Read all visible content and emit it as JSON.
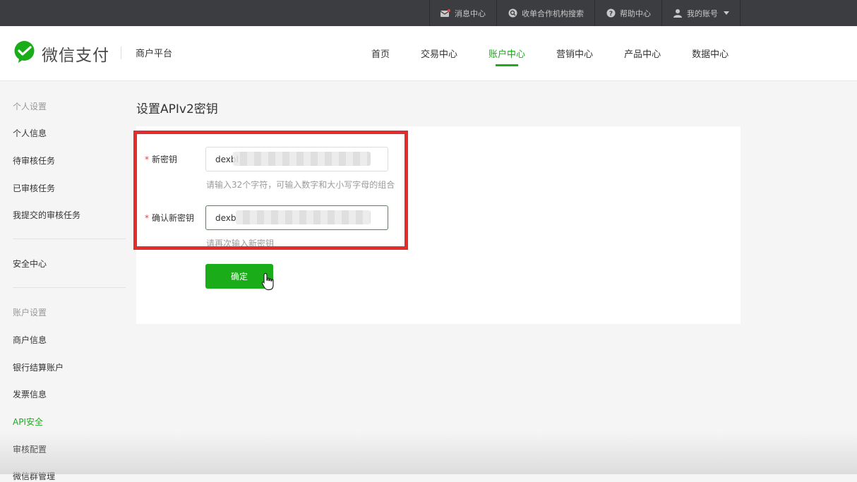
{
  "topbar": {
    "items": [
      {
        "label": "消息中心",
        "icon": "message-icon"
      },
      {
        "label": "收单合作机构搜索",
        "icon": "search-icon"
      },
      {
        "label": "帮助中心",
        "icon": "help-icon"
      },
      {
        "label": "我的账号",
        "icon": "user-icon"
      }
    ]
  },
  "header": {
    "logo_text": "微信支付",
    "platform": "商户平台",
    "nav": [
      {
        "label": "首页"
      },
      {
        "label": "交易中心"
      },
      {
        "label": "账户中心"
      },
      {
        "label": "营销中心"
      },
      {
        "label": "产品中心"
      },
      {
        "label": "数据中心"
      }
    ],
    "active_nav": "账户中心"
  },
  "sidebar": {
    "group1_title": "个人设置",
    "group1_items": [
      "个人信息",
      "待审核任务",
      "已审核任务",
      "我提交的审核任务"
    ],
    "security": "安全中心",
    "group2_title": "账户设置",
    "group2_items": [
      "商户信息",
      "银行结算账户",
      "发票信息",
      "API安全",
      "审核配置",
      "微信群管理"
    ],
    "active_item": "API安全"
  },
  "main": {
    "title": "设置APIv2密钥",
    "form": {
      "new_key_label": "新密钥",
      "new_key_value": "dexbl",
      "new_key_hint": "请输入32个字符，可输入数字和大小写字母的组合",
      "confirm_key_label": "确认新密钥",
      "confirm_key_value": "dexb",
      "confirm_key_hint": "请再次输入新密钥",
      "required_mark": "*",
      "submit_label": "确定"
    }
  },
  "colors": {
    "brand_green": "#1aad19",
    "topbar_bg": "#3c3d40",
    "highlight_red": "#e32d2d"
  }
}
